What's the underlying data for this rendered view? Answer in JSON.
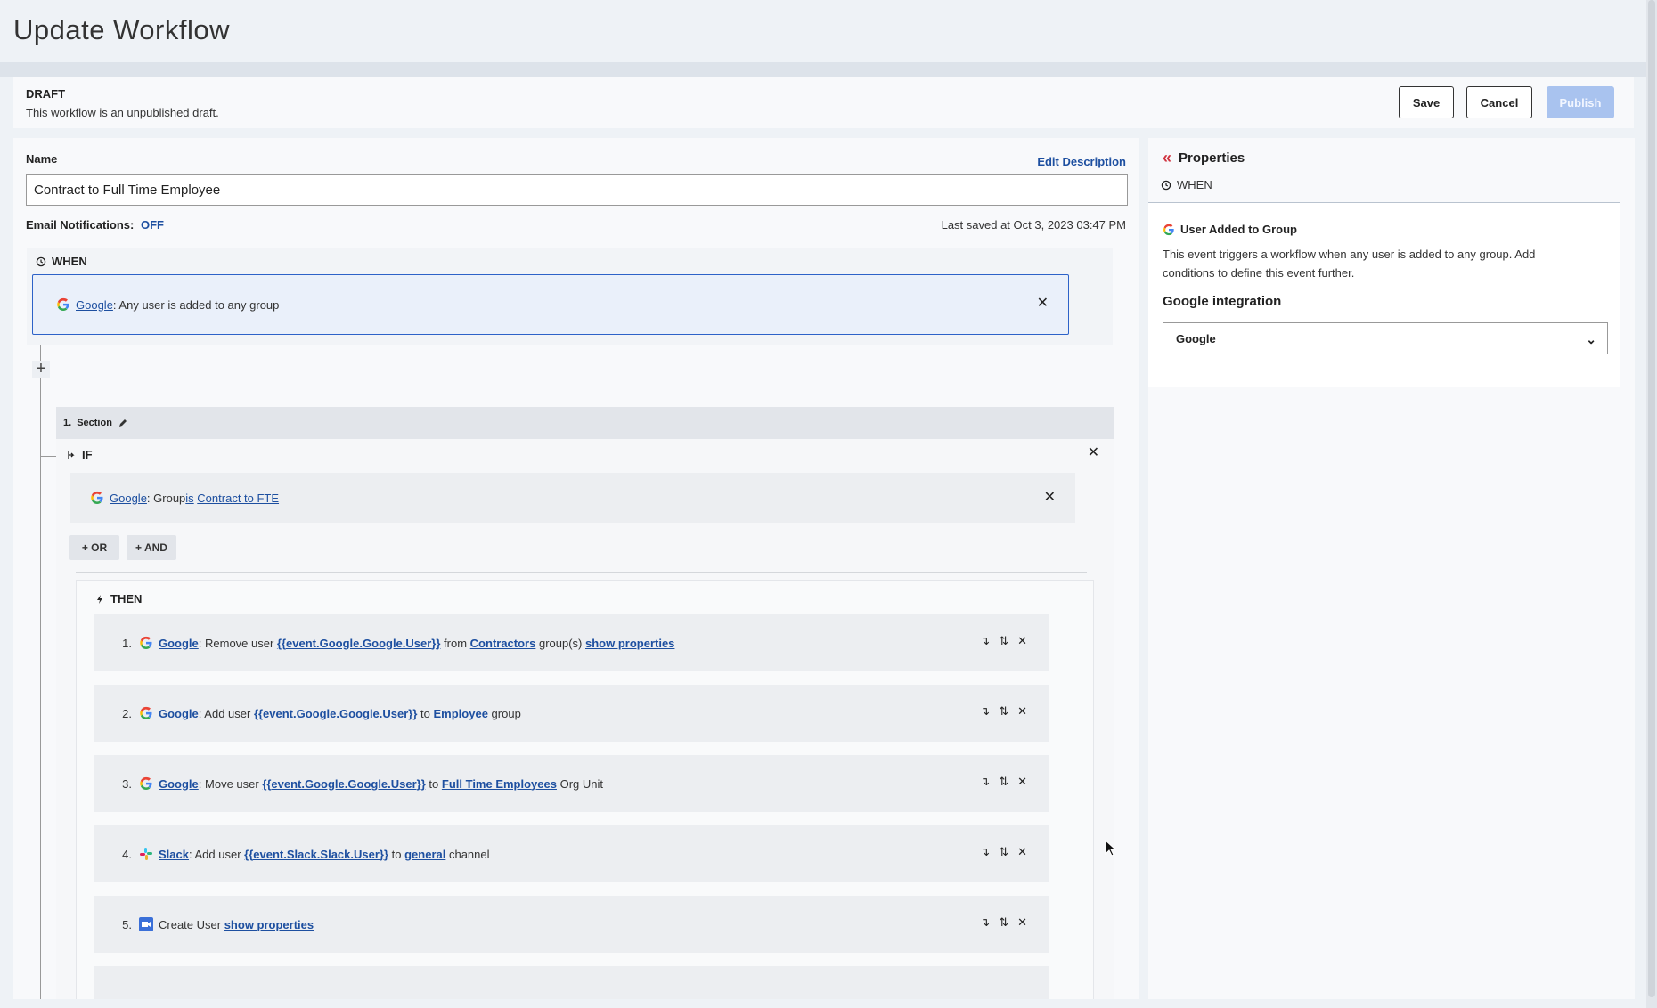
{
  "header": {
    "title": "Update Workflow"
  },
  "draft": {
    "label": "DRAFT",
    "subtitle": "This workflow is an unpublished draft.",
    "save": "Save",
    "cancel": "Cancel",
    "publish": "Publish"
  },
  "form": {
    "name_label": "Name",
    "edit_description": "Edit Description",
    "name_value": "Contract to Full Time Employee",
    "email_label": "Email Notifications:",
    "email_value": "OFF",
    "last_saved": "Last saved at Oct 3, 2023 03:47 PM"
  },
  "when": {
    "label": "WHEN",
    "trigger_app": "Google",
    "trigger_text": ": Any user is added to any group"
  },
  "section": {
    "num": "1.",
    "label": "Section"
  },
  "if": {
    "label": "IF",
    "condition": {
      "app": "Google",
      "t1": ": Group ",
      "op": "is",
      "value": "Contract to FTE"
    },
    "or": "+ OR",
    "and": "+ AND"
  },
  "then": {
    "label": "THEN",
    "actions": [
      {
        "num": "1.",
        "app": "Google",
        "t1": ": Remove user ",
        "var": "{{event.Google.Google.User}}",
        "t2": " from ",
        "target": "Contractors",
        "t3": " group(s) ",
        "link": "show properties"
      },
      {
        "num": "2.",
        "app": "Google",
        "t1": ": Add user ",
        "var": "{{event.Google.Google.User}}",
        "t2": " to ",
        "target": "Employee",
        "t3": " group",
        "link": ""
      },
      {
        "num": "3.",
        "app": "Google",
        "t1": ": Move user ",
        "var": "{{event.Google.Google.User}}",
        "t2": " to ",
        "target": "Full Time Employees",
        "t3": " Org Unit",
        "link": ""
      },
      {
        "num": "4.",
        "app": "Slack",
        "t1": ": Add user ",
        "var": "{{event.Slack.Slack.User}}",
        "t2": " to ",
        "target": "general",
        "t3": " channel",
        "link": ""
      },
      {
        "num": "5.",
        "app": "",
        "t1": "Create User ",
        "var": "",
        "t2": "",
        "target": "",
        "t3": "",
        "link": "show properties"
      }
    ]
  },
  "properties": {
    "title": "Properties",
    "when": "WHEN",
    "event_title": "User Added to Group",
    "event_desc": "This event triggers a workflow when any user is added to any group. Add conditions to define this event further.",
    "integration_label": "Google integration",
    "integration_value": "Google"
  },
  "colors": {
    "accent": "#2d62c8",
    "link": "#1d4fa0",
    "publish": "#a9c3ef",
    "collapse": "#d0333f"
  },
  "icons": {
    "when": "clock-refresh-icon",
    "if": "branch-icon",
    "then": "lightning-icon",
    "app": "google-icon",
    "slack": "slack-icon",
    "create": "video-icon"
  }
}
